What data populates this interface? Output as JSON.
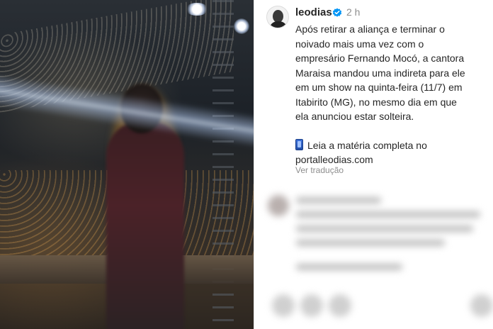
{
  "post": {
    "username": "leodias",
    "time": "2 h",
    "caption_lines": [
      "Após retirar a aliança e terminar o",
      "noivado mais uma vez com o",
      "empresário Fernando Mocó, a cantora",
      "Maraisa mandou uma indireta para ele",
      "em um show na quinta-feira (11/7) em",
      "Itabirito (MG), no mesmo dia em que",
      "ela anunciou estar solteira."
    ],
    "link_line_1": "Leia a matéria completa no",
    "link_line_2": "portalleodias.com",
    "translate_label": "Ver tradução"
  },
  "icons": {
    "verified": "verified-badge-icon",
    "phone": "mobile-phone-icon"
  },
  "colors": {
    "verified": "#0095f6",
    "text": "#262626",
    "muted": "#8e8e8e"
  }
}
